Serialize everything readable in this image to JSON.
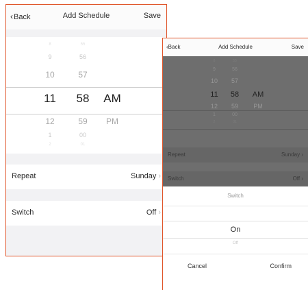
{
  "left": {
    "nav": {
      "back_label": "Back",
      "title": "Add Schedule",
      "save_label": "Save"
    },
    "picker": {
      "hours": [
        "8",
        "9",
        "10",
        "11",
        "12",
        "1",
        "2"
      ],
      "minutes": [
        "55",
        "56",
        "57",
        "58",
        "59",
        "00",
        "01"
      ],
      "periods": [
        "AM",
        "PM"
      ],
      "selected": {
        "hour": "11",
        "minute": "58",
        "period": "AM"
      }
    },
    "rows": [
      {
        "label": "Repeat",
        "value": "Sunday"
      },
      {
        "label": "Switch",
        "value": "Off"
      }
    ]
  },
  "right": {
    "nav": {
      "back_label": "Back",
      "title": "Add Schedule",
      "save_label": "Save"
    },
    "picker": {
      "hours": [
        "8",
        "9",
        "10",
        "11",
        "12",
        "1",
        "2"
      ],
      "minutes": [
        "55",
        "56",
        "57",
        "58",
        "59",
        "00",
        "01"
      ],
      "periods": [
        "AM",
        "PM"
      ]
    },
    "rows": [
      {
        "label": "Repeat",
        "value": "Sunday"
      },
      {
        "label": "Switch",
        "value": "Off"
      }
    ],
    "sheet": {
      "title": "Switch",
      "options": [
        "On",
        "Off"
      ],
      "selected": "On",
      "cancel_label": "Cancel",
      "confirm_label": "Confirm"
    }
  },
  "colors": {
    "highlight_border": "#e0552a",
    "dim_overlay": "#6e6e6e"
  }
}
